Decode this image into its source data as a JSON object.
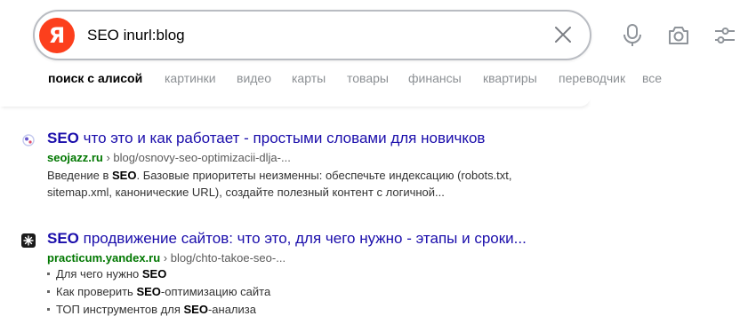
{
  "search": {
    "logo_letter": "Я",
    "query": "SEO inurl:blog"
  },
  "icons": {
    "clear": "close-icon",
    "voice": "microphone-icon",
    "camera": "camera-icon",
    "filters": "settings-sliders-icon"
  },
  "colors": {
    "logo_bg": "#fc3f1d",
    "link": "#1a0dab",
    "url_green": "#007700"
  },
  "tabs": [
    {
      "label": "поиск с алисой",
      "active": true
    },
    {
      "label": "картинки"
    },
    {
      "label": "видео"
    },
    {
      "label": "карты"
    },
    {
      "label": "товары"
    },
    {
      "label": "финансы"
    },
    {
      "label": "квартиры"
    },
    {
      "label": "переводчик"
    },
    {
      "label": "все"
    }
  ],
  "results": [
    {
      "title_bold": "SEO",
      "title_rest": " что это и как работает - простыми словами для новичков",
      "domain": "seojazz.ru",
      "path": " › blog/osnovy-seo-optimizacii-dlja-...",
      "snippet": [
        {
          "t": "Введение в "
        },
        {
          "t": "SEO",
          "b": true
        },
        {
          "t": ". Базовые приоритеты неизменны: обеспечьте индексацию (robots.txt, sitemap.xml, канонические URL), создайте полезный контент с логичной..."
        }
      ]
    },
    {
      "title_bold": "SEO",
      "title_rest": " продвижение сайтов: что это, для чего нужно - этапы и сроки...",
      "domain": "practicum.yandex.ru",
      "path": " › blog/chto-takoe-seo-...",
      "bullets": [
        [
          {
            "t": "Для чего нужно "
          },
          {
            "t": "SEO",
            "b": true
          }
        ],
        [
          {
            "t": "Как проверить "
          },
          {
            "t": "SEO",
            "b": true
          },
          {
            "t": "-оптимизацию сайта"
          }
        ],
        [
          {
            "t": "ТОП инструментов для "
          },
          {
            "t": "SEO",
            "b": true
          },
          {
            "t": "-анализа"
          }
        ]
      ]
    }
  ]
}
